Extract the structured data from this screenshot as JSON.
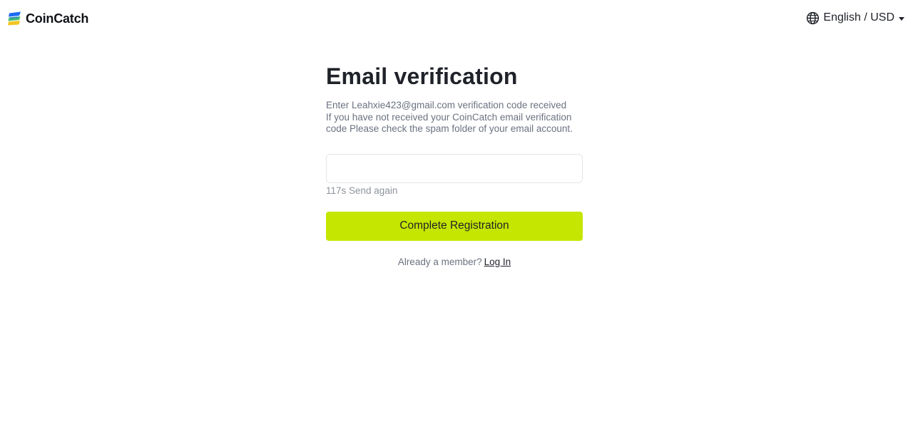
{
  "header": {
    "logo_text": "CoinCatch",
    "logo_colors": {
      "blue": "#1d6bf3",
      "green": "#46c16c",
      "yellow": "#f3c623"
    },
    "language_currency": "English / USD",
    "globe_icon": "globe-icon",
    "caret_icon": "caret-down-icon"
  },
  "form": {
    "title": "Email verification",
    "description_lines": [
      "Enter Leahxie423@gmail.com verification code received",
      "If you have not received your CoinCatch email verification",
      "code Please check the spam folder of your email account."
    ],
    "code_input_value": "",
    "code_input_placeholder": "",
    "resend_text": "117s Send again",
    "submit_label": "Complete Registration",
    "member_prompt": "Already a member?",
    "login_link": "Log In"
  },
  "colors": {
    "accent": "#c5e600",
    "text_primary": "#1f2229",
    "text_muted": "#6b7280",
    "input_border": "#e3e5e8"
  }
}
